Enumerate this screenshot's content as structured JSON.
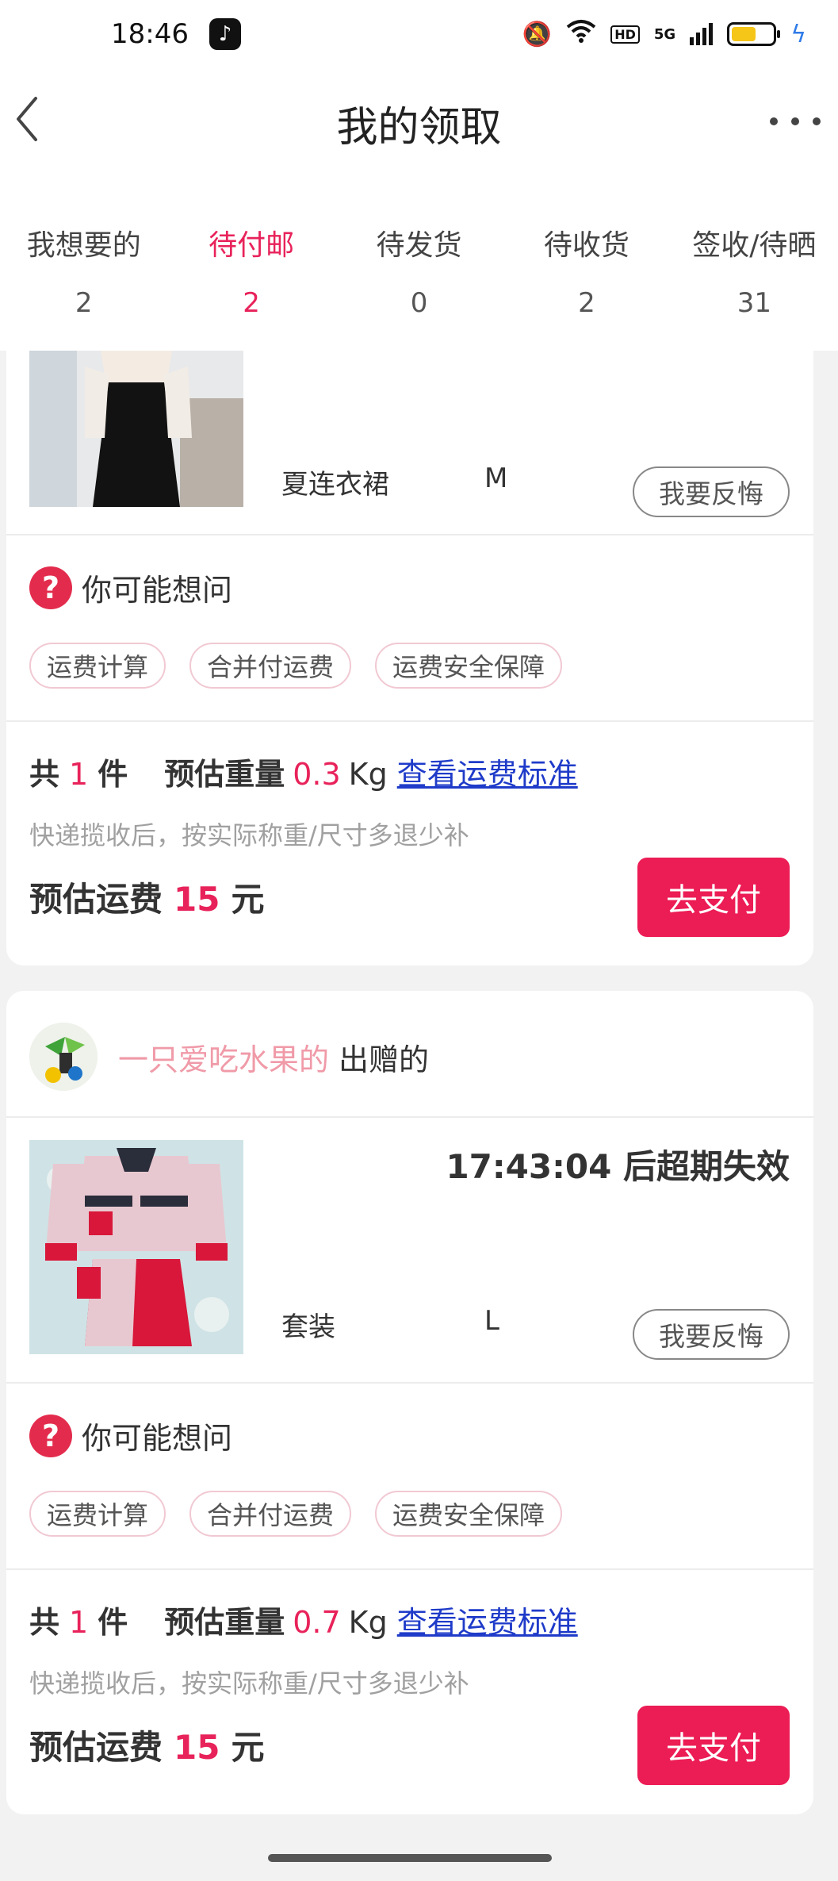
{
  "status_bar": {
    "time": "18:46",
    "app_icon": "tiktok-icon",
    "hd": "HD",
    "network": "5G",
    "battery_level": 0.6,
    "colors": {
      "battery": "#f5c518",
      "charging": "#2f7be8"
    }
  },
  "header": {
    "title": "我的领取"
  },
  "tabs": [
    {
      "label": "我想要的",
      "count": "2"
    },
    {
      "label": "待付邮",
      "count": "2",
      "active": true
    },
    {
      "label": "待发货",
      "count": "0"
    },
    {
      "label": "待收货",
      "count": "2"
    },
    {
      "label": "签收/待晒",
      "count": "31"
    }
  ],
  "theme": {
    "accent": "#e8225a",
    "pay_button": "#ec1c55",
    "link": "#1f3bc9"
  },
  "orders": [
    {
      "item_name": "夏连衣裙",
      "size": "M",
      "regret_label": "我要反悔",
      "faq_title": "你可能想问",
      "faq_icon": "question-icon",
      "faq_tags": [
        "运费计算",
        "合并付运费",
        "运费安全保障"
      ],
      "count_prefix": "共",
      "count": "1",
      "count_suffix": "件",
      "weight_label": "预估重量",
      "weight": "0.3",
      "weight_unit": "Kg",
      "standard_link": "查看运费标准",
      "note": "快递揽收后，按实际称重/尺寸多退少补",
      "fee_label": "预估运费",
      "fee": "15",
      "fee_unit": "元",
      "pay_label": "去支付"
    },
    {
      "giver_name": "一只爱吃水果的",
      "giver_suffix": "出赠的",
      "expire_text": "17:43:04 后超期失效",
      "item_name": "套装",
      "size": "L",
      "regret_label": "我要反悔",
      "faq_title": "你可能想问",
      "faq_icon": "question-icon",
      "faq_tags": [
        "运费计算",
        "合并付运费",
        "运费安全保障"
      ],
      "count_prefix": "共",
      "count": "1",
      "count_suffix": "件",
      "weight_label": "预估重量",
      "weight": "0.7",
      "weight_unit": "Kg",
      "standard_link": "查看运费标准",
      "note": "快递揽收后，按实际称重/尺寸多退少补",
      "fee_label": "预估运费",
      "fee": "15",
      "fee_unit": "元",
      "pay_label": "去支付"
    }
  ]
}
